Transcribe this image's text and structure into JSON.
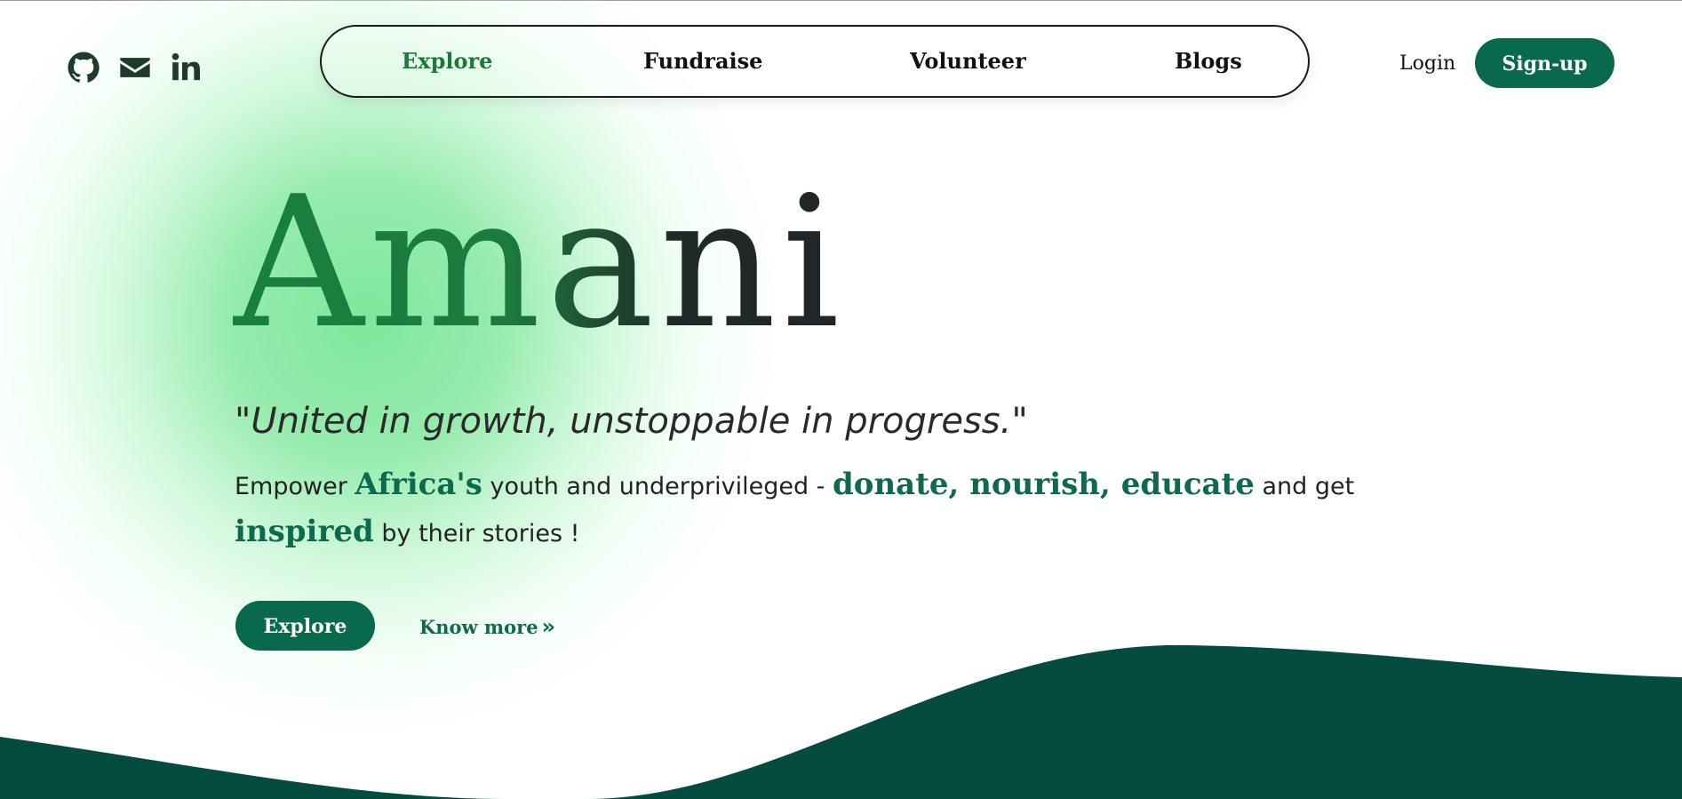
{
  "social": {
    "github_icon": "github-icon",
    "mail_icon": "mail-icon",
    "linkedin_icon": "linkedin-icon"
  },
  "nav": {
    "items": [
      {
        "label": "Explore",
        "active": true
      },
      {
        "label": "Fundraise",
        "active": false
      },
      {
        "label": "Volunteer",
        "active": false
      },
      {
        "label": "Blogs",
        "active": false
      }
    ]
  },
  "auth": {
    "login_label": "Login",
    "signup_label": "Sign-up"
  },
  "hero": {
    "title": "Amani",
    "tagline": "\"United in growth, unstoppable in progress.\"",
    "description": {
      "part1": "Empower ",
      "em1": "Africa's",
      "part2": " youth and underprivileged - ",
      "em2": "donate, nourish, educate",
      "part3": " and get ",
      "em3": "inspired",
      "part4": " by their stories !"
    },
    "explore_label": "Explore",
    "know_more_label": "Know more",
    "know_more_icon": "»"
  },
  "colors": {
    "brand": "#08694d",
    "accent_green": "#1a7a3a",
    "wave": "#044c3f",
    "glow": "#7fe79e"
  }
}
